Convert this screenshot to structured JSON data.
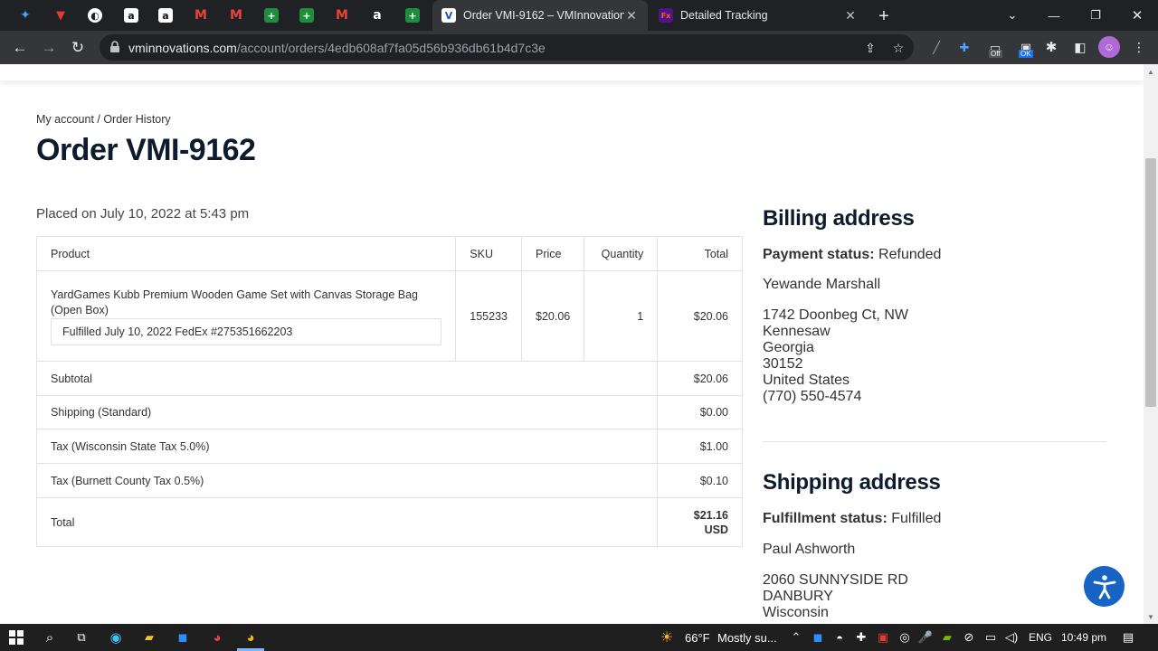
{
  "browser": {
    "tabs": [
      {
        "title": "Order VMI-9162 – VMInnovation",
        "active": true
      },
      {
        "title": "Detailed Tracking",
        "active": false
      }
    ],
    "pinned_icons": [
      "dropbox-icon",
      "app-icon",
      "globe-icon",
      "amazon-icon",
      "amazon-icon",
      "gmail-icon",
      "gmail-icon",
      "sheets-icon",
      "sheets-icon",
      "gmail-icon",
      "amazon-icon",
      "sheets-icon"
    ],
    "url_host": "vminnovations.com",
    "url_path": "/account/orders/4edb608af7fa05d56b936db61b4d7c3e",
    "ext_badges": {
      "off": "Off",
      "ok": "OK"
    }
  },
  "page": {
    "breadcrumb": "My account / Order History",
    "title": "Order VMI-9162",
    "placed_on": "Placed on July 10, 2022 at 5:43 pm",
    "table": {
      "headers": {
        "product": "Product",
        "sku": "SKU",
        "price": "Price",
        "quantity": "Quantity",
        "total": "Total"
      },
      "item": {
        "product": "YardGames Kubb Premium Wooden Game Set with Canvas Storage Bag (Open Box)",
        "fulfillment": "Fulfilled July 10, 2022 FedEx #275351662203",
        "sku": "155233",
        "price": "$20.06",
        "quantity": "1",
        "total": "$20.06"
      },
      "rows": [
        {
          "label": "Subtotal",
          "value": "$20.06"
        },
        {
          "label": "Shipping (Standard)",
          "value": "$0.00"
        },
        {
          "label": "Tax (Wisconsin State Tax 5.0%)",
          "value": "$1.00"
        },
        {
          "label": "Tax (Burnett County Tax 0.5%)",
          "value": "$0.10"
        }
      ],
      "total_label": "Total",
      "total_value": "$21.16",
      "total_currency": "USD"
    },
    "billing": {
      "heading": "Billing address",
      "status_label": "Payment status:",
      "status_value": "Refunded",
      "name": "Yewande Marshall",
      "lines": [
        "1742 Doonbeg Ct, NW",
        "Kennesaw",
        "Georgia",
        "30152",
        "United States",
        "(770) 550-4574"
      ]
    },
    "shipping": {
      "heading": "Shipping address",
      "status_label": "Fulfillment status:",
      "status_value": "Fulfilled",
      "name": "Paul Ashworth",
      "lines": [
        "2060 SUNNYSIDE RD",
        "DANBURY",
        "Wisconsin"
      ]
    }
  },
  "taskbar": {
    "weather_temp": "66°F",
    "weather_desc": "Mostly su...",
    "language": "ENG",
    "time": "10:49 pm"
  },
  "colors": {
    "title_navy": "#0d1b2e",
    "accessibility_blue": "#1764c4",
    "chrome_dark": "#202124"
  }
}
